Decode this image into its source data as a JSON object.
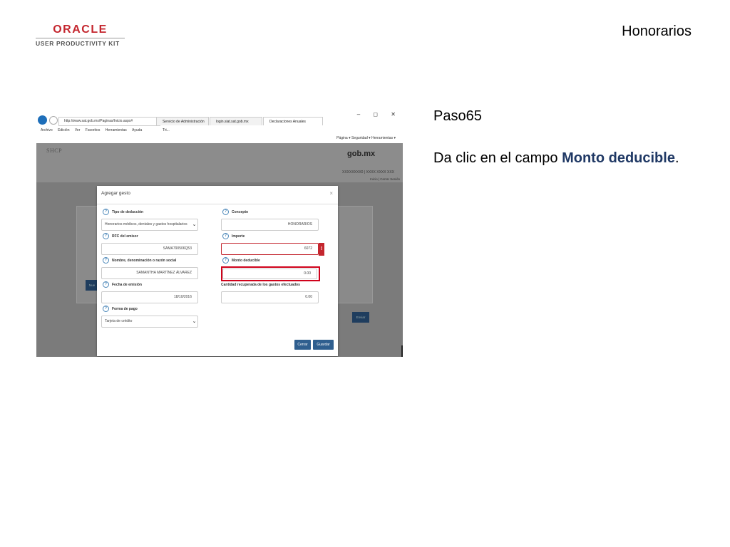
{
  "header": {
    "logo_word": "ORACLE",
    "logo_sub": "USER PRODUCTIVITY KIT",
    "title": "Honorarios"
  },
  "instructions": {
    "step": "Paso65",
    "text_before": "Da clic en el campo ",
    "field_name": "Monto deducible",
    "text_after": "."
  },
  "browser": {
    "url": "http://www.sat.gob.mx/Paginas/Inicio.aspx#",
    "tabs": [
      "Servicio de Administración Tri...",
      "login.siat.sat.gob.mx",
      "Declaraciones Anuales"
    ],
    "window_controls": "–  ◻  ✕",
    "menu": [
      "Archivo",
      "Edición",
      "Ver",
      "Favoritos",
      "Herramientas",
      "Ayuda"
    ],
    "toolbar": "Página ▾  Seguridad ▾  Herramientas ▾"
  },
  "site": {
    "agency": "SHCP",
    "brand": "gob.mx",
    "rfc_line": "XXXXXXXX0 | XXXX XXXX XXX",
    "session_line": "Inicio | Cerrar Sesión",
    "bg_buttons": [
      "Nue",
      "Enviar"
    ]
  },
  "modal": {
    "title": "Agregar gesto",
    "close": "×",
    "fields": {
      "tipo_label": "Tipo de deducción",
      "tipo_value": "Honorarios médicos, dentales y gastos hospitalarios",
      "concepto_label": "Concepto",
      "concepto_value": "HONORARIOS",
      "rfc_label": "RFC del emisor",
      "rfc_value": "SAMA790506Q53",
      "importe_label": "Importe",
      "importe_value": "6072",
      "error_flag": "!",
      "nombre_label": "Nombre, denominación o razón social",
      "nombre_value": "SAMANTHA MARTÍNEZ ÁLVAREZ",
      "monto_label": "Monto deducible",
      "monto_value": "0.00",
      "fecha_label": "Fecha de emisión",
      "fecha_value": "18/10/2016",
      "cantidad_label": "Cantidad recuperada de los gastos efectuados",
      "cantidad_value": "0.00",
      "forma_label": "Forma de pago",
      "forma_value": "Tarjeta de crédito"
    },
    "buttons": {
      "cancel": "Cerrar",
      "save": "Guardar"
    },
    "help_glyph": "?"
  },
  "colors": {
    "oracle_red": "#c4262e",
    "highlight": "#d0021b",
    "button_blue": "#2f5f8f"
  }
}
